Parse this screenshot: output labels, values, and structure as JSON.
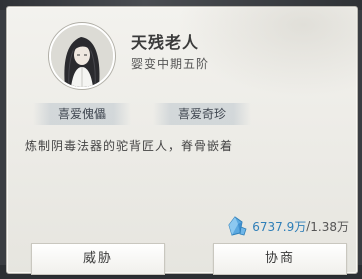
{
  "npc": {
    "name": "天残老人",
    "realm": "婴变中期五阶",
    "tags": [
      "喜爱傀儡",
      "喜爱奇珍"
    ],
    "description": "炼制阴毒法器的驼背匠人，脊骨嵌着"
  },
  "currency": {
    "icon": "crystal-icon",
    "current": "6737.9万",
    "separator": "/",
    "max": "1.38万"
  },
  "actions": {
    "threaten_label": "威胁",
    "negotiate_label": "协商"
  },
  "colors": {
    "currency_value": "#2f7fb8",
    "panel_bg": "#f0efea"
  }
}
